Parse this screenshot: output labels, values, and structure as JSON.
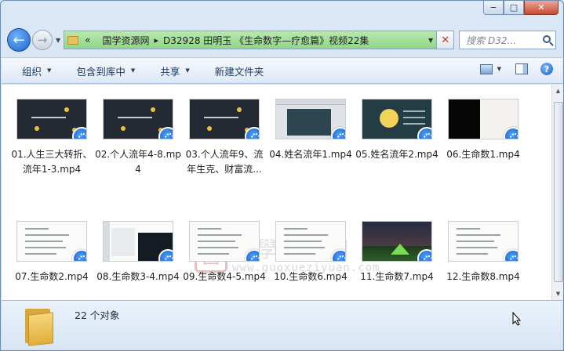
{
  "window": {
    "caption_min": "−",
    "caption_max": "□",
    "caption_close": "✕"
  },
  "nav": {
    "back_icon": "back-arrow-icon",
    "forward_icon": "forward-arrow-icon",
    "breadcrumb_prefix": "«",
    "breadcrumb": [
      "国学资源网",
      "D32928 田明玉 《生命数字—疗愈篇》视频22集"
    ],
    "search_placeholder": "搜索 D32...",
    "address_progress": 1.0
  },
  "toolbar": {
    "items": [
      "组织",
      "包含到库中",
      "共享",
      "新建文件夹"
    ],
    "help_label": "?"
  },
  "files": [
    {
      "name": "01.人生三大转折、流年1-3.mp4",
      "thumb": "dark"
    },
    {
      "name": "02.个人流年4-8.mp4",
      "thumb": "dark"
    },
    {
      "name": "03.个人流年9、流年生克、财富流...",
      "thumb": "dark"
    },
    {
      "name": "04.姓名流年1.mp4",
      "thumb": "ppt"
    },
    {
      "name": "05.姓名流年2.mp4",
      "thumb": "teal"
    },
    {
      "name": "06.生命数1.mp4",
      "thumb": "black"
    },
    {
      "name": "07.生命数2.mp4",
      "thumb": "white"
    },
    {
      "name": "08.生命数3-4.mp4",
      "thumb": "side"
    },
    {
      "name": "09.生命数4-5.mp4",
      "thumb": "white"
    },
    {
      "name": "10.生命数6.mp4",
      "thumb": "white"
    },
    {
      "name": "11.生命数7.mp4",
      "thumb": "night"
    },
    {
      "name": "12.生命数8.mp4",
      "thumb": "white"
    }
  ],
  "watermark": {
    "seal": "國",
    "cn": "國學資源網",
    "url": "www.guoxueziyuan.com"
  },
  "status": {
    "count": "22 个对象"
  }
}
